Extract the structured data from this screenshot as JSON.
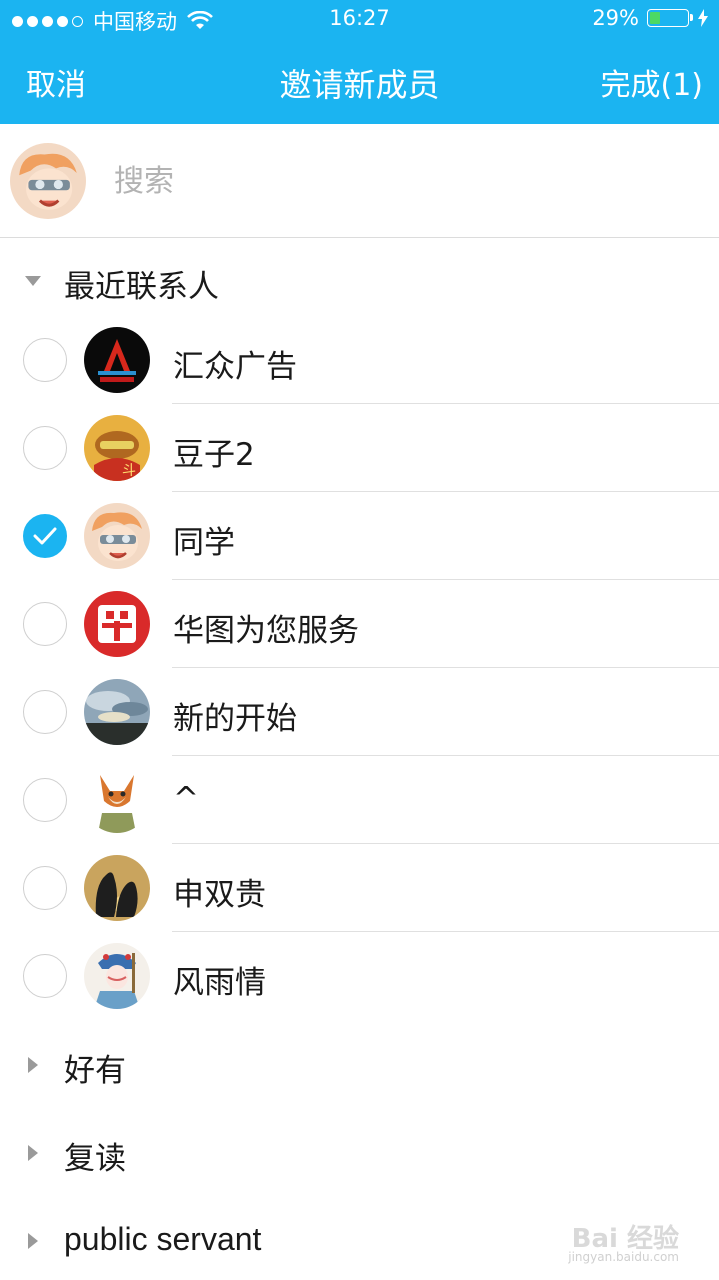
{
  "status_bar": {
    "carrier": "中国移动",
    "time": "16:27",
    "battery_percent": "29%",
    "battery_level": 0.29
  },
  "nav": {
    "cancel_label": "取消",
    "title": "邀请新成员",
    "done_label": "完成(1)"
  },
  "search": {
    "placeholder": "搜索"
  },
  "groups": {
    "recent": {
      "label": "最近联系人",
      "expanded": true
    },
    "friends": {
      "label": "好有",
      "expanded": false
    },
    "classmates": {
      "label": "复读",
      "expanded": false
    },
    "public": {
      "label": "public servant",
      "expanded": false
    }
  },
  "contacts": [
    {
      "name": "汇众广告",
      "checked": false,
      "avatar_icon": "flame-logo-icon"
    },
    {
      "name": "豆子2",
      "checked": false,
      "avatar_icon": "game-character-icon"
    },
    {
      "name": "同学",
      "checked": true,
      "avatar_icon": "cartoon-boy-icon"
    },
    {
      "name": "华图为您服务",
      "checked": false,
      "avatar_icon": "huatu-logo-icon"
    },
    {
      "name": "新的开始",
      "checked": false,
      "avatar_icon": "sky-landscape-icon"
    },
    {
      "name": "^",
      "checked": false,
      "avatar_icon": "fox-cartoon-icon"
    },
    {
      "name": "申双贵",
      "checked": false,
      "avatar_icon": "penguin-silhouette-icon"
    },
    {
      "name": "风雨情",
      "checked": false,
      "avatar_icon": "opera-figure-icon"
    }
  ],
  "watermark": {
    "brand": "Bai 经验",
    "url": "jingyan.baidu.com"
  },
  "colors": {
    "accent": "#1bb4f1",
    "battery_green": "#4cd964",
    "separator": "#dcdcdc"
  }
}
